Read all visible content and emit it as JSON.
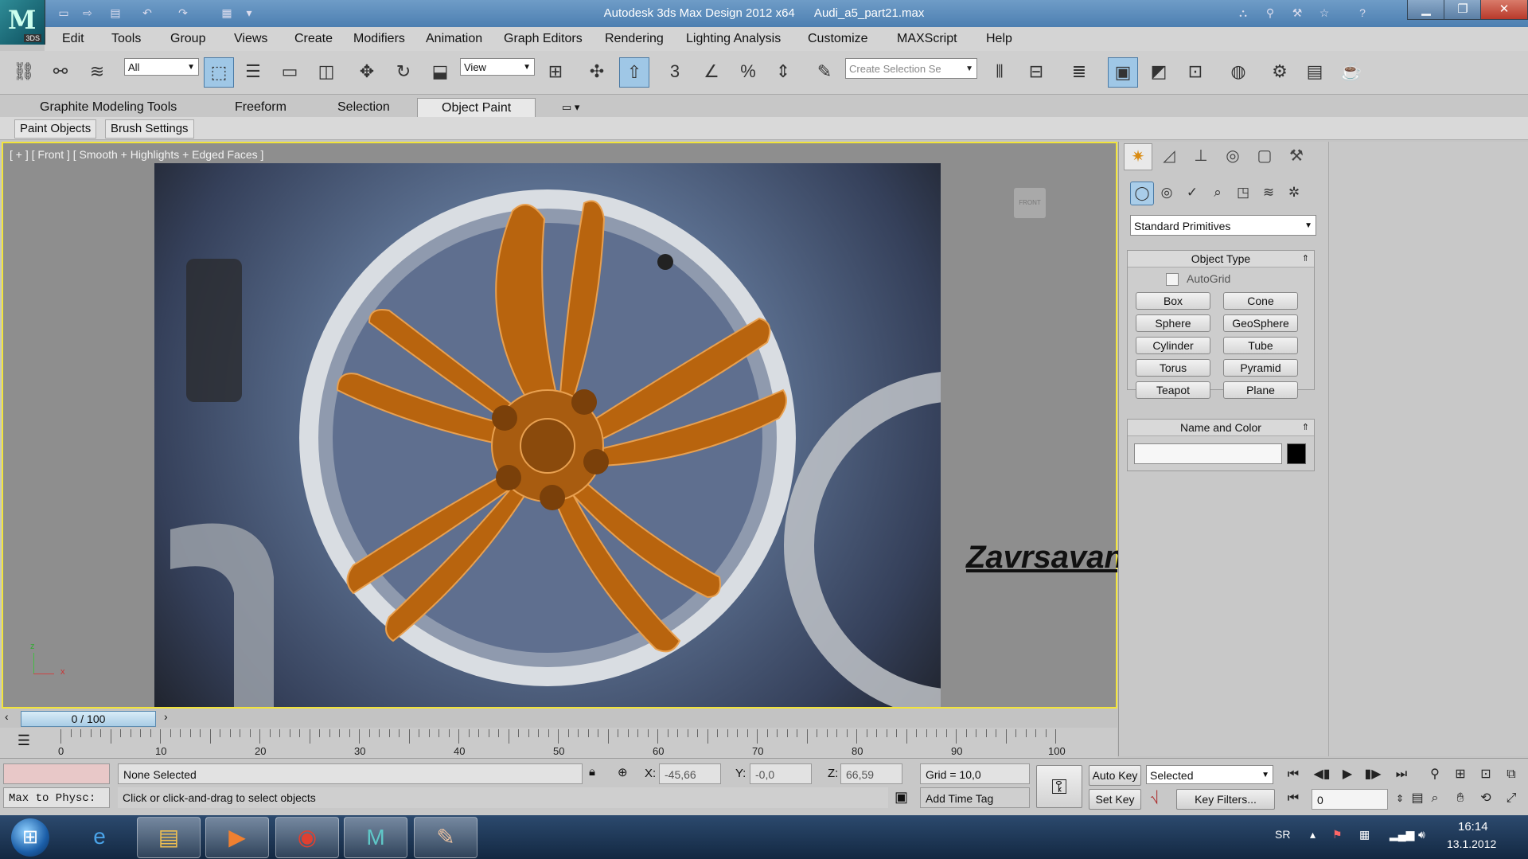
{
  "window": {
    "title": "Autodesk 3ds Max Design 2012 x64      Audi_a5_part21.max",
    "app_badge": "3DS"
  },
  "menubar": [
    "Edit",
    "Tools",
    "Group",
    "Views",
    "Create",
    "Modifiers",
    "Animation",
    "Graph Editors",
    "Rendering",
    "Lighting Analysis",
    "Customize",
    "MAXScript",
    "Help"
  ],
  "toolbar": {
    "filter_value": "All",
    "refcoord_value": "View",
    "selection_set_placeholder": "Create Selection Se"
  },
  "ribbon": {
    "tabs": [
      "Graphite Modeling Tools",
      "Freeform",
      "Selection",
      "Object Paint"
    ],
    "active_tab": "Object Paint",
    "subtabs": [
      "Paint Objects",
      "Brush Settings"
    ]
  },
  "viewport": {
    "label": "[ + ] [ Front ] [ Smooth + Highlights + Edged Faces ]",
    "viewcube_label": "FRONT",
    "axis_z": "z",
    "axis_x": "x",
    "caption": "Zavrsavanje felne"
  },
  "command_panel": {
    "category_value": "Standard Primitives",
    "object_type_title": "Object Type",
    "autogrid_label": "AutoGrid",
    "primitives": [
      "Box",
      "Cone",
      "Sphere",
      "GeoSphere",
      "Cylinder",
      "Tube",
      "Torus",
      "Pyramid",
      "Teapot",
      "Plane"
    ],
    "name_color_title": "Name and Color",
    "name_value": "",
    "object_color": "#000000"
  },
  "timeline": {
    "frame_display": "0 / 100",
    "ticks": [
      "0",
      "10",
      "20",
      "30",
      "40",
      "50",
      "60",
      "70",
      "80",
      "90",
      "100"
    ]
  },
  "status": {
    "maxscript_listener": "Max to Physc:",
    "selection": "None Selected",
    "prompt": "Click or click-and-drag to select objects",
    "x_label": "X:",
    "x_value": "-45,66",
    "y_label": "Y:",
    "y_value": "-0,0",
    "z_label": "Z:",
    "z_value": "66,59",
    "grid": "Grid = 10,0",
    "add_time_tag": "Add Time Tag",
    "auto_key": "Auto Key",
    "set_key": "Set Key",
    "key_mode_value": "Selected",
    "key_filters": "Key Filters...",
    "current_frame": "0"
  },
  "taskbar": {
    "language": "SR",
    "time": "16:14",
    "date": "13.1.2012"
  },
  "colors": {
    "viewport_border": "#f2e43a",
    "mesh": "#b8640e",
    "accent": "#4d7fb1"
  }
}
